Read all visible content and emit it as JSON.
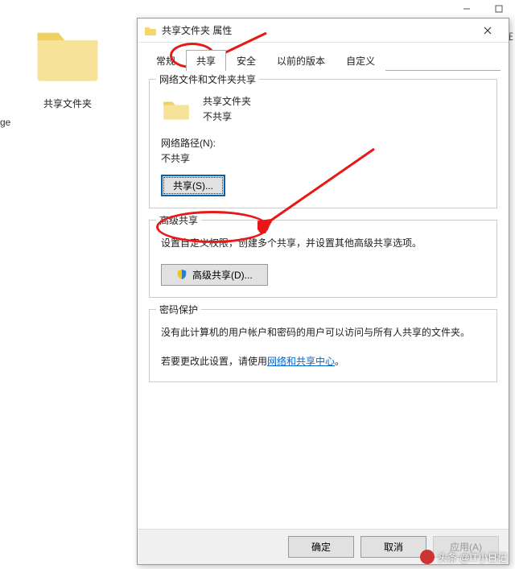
{
  "desktop": {
    "folder_label": "共享文件夹",
    "left_label": "ge"
  },
  "right_edge_label": "在",
  "dialog": {
    "title": "共享文件夹 属性",
    "tabs": [
      "常规",
      "共享",
      "安全",
      "以前的版本",
      "自定义"
    ],
    "active_tab_index": 1,
    "group_network": {
      "title": "网络文件和文件夹共享",
      "folder_name": "共享文件夹",
      "share_status": "不共享",
      "path_label": "网络路径(N):",
      "path_value": "不共享",
      "share_button": "共享(S)..."
    },
    "group_advanced": {
      "title": "高级共享",
      "desc": "设置自定义权限，创建多个共享，并设置其他高级共享选项。",
      "button": "高级共享(D)..."
    },
    "group_password": {
      "title": "密码保护",
      "line1": "没有此计算机的用户帐户和密码的用户可以访问与所有人共享的文件夹。",
      "line2_prefix": "若要更改此设置，请使用",
      "link": "网络和共享中心",
      "line2_suffix": "。"
    },
    "footer": {
      "ok": "确定",
      "cancel": "取消",
      "apply": "应用(A)"
    }
  },
  "watermark": "头条 @IT小日记"
}
